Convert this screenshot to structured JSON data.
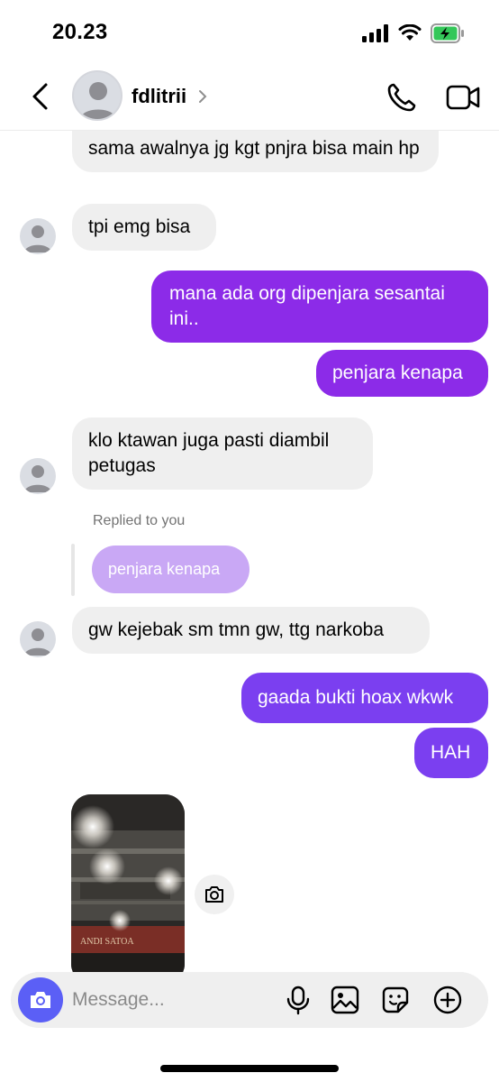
{
  "status_bar": {
    "time": "20.23",
    "battery_color": "#34c759"
  },
  "header": {
    "username": "fdlitrii"
  },
  "messages": [
    {
      "side": "in",
      "text": "sama awalnya jg kgt pnjra bisa main hp"
    },
    {
      "side": "in",
      "text": "tpi emg bisa"
    },
    {
      "side": "out",
      "text": "mana ada org dipenjara sesantai ini.."
    },
    {
      "side": "out",
      "text": "penjara kenapa"
    },
    {
      "side": "in",
      "text": "klo ktawan juga pasti diambil petugas"
    },
    {
      "side": "in",
      "text": "gw kejebak sm tmn gw, ttg narkoba",
      "reply_label": "Replied to you",
      "reply_quote": "penjara kenapa"
    },
    {
      "side": "out",
      "text": "gaada bukti hoax wkwk"
    },
    {
      "side": "out",
      "text": "HAH"
    }
  ],
  "photo_sign_text": "ANDI SATOA",
  "composer": {
    "placeholder": "Message..."
  },
  "colors": {
    "outgoing": "#8c2be8",
    "outgoing_alt": "#7b3ff0",
    "incoming": "#efefef",
    "camera": "#5b5ff6",
    "reply": "#c9a8f5"
  },
  "icons": [
    "back-icon",
    "chevron-right-icon",
    "phone-icon",
    "video-camera-icon",
    "camera-icon",
    "share-icon",
    "microphone-icon",
    "gallery-icon",
    "sticker-icon",
    "plus-icon"
  ]
}
